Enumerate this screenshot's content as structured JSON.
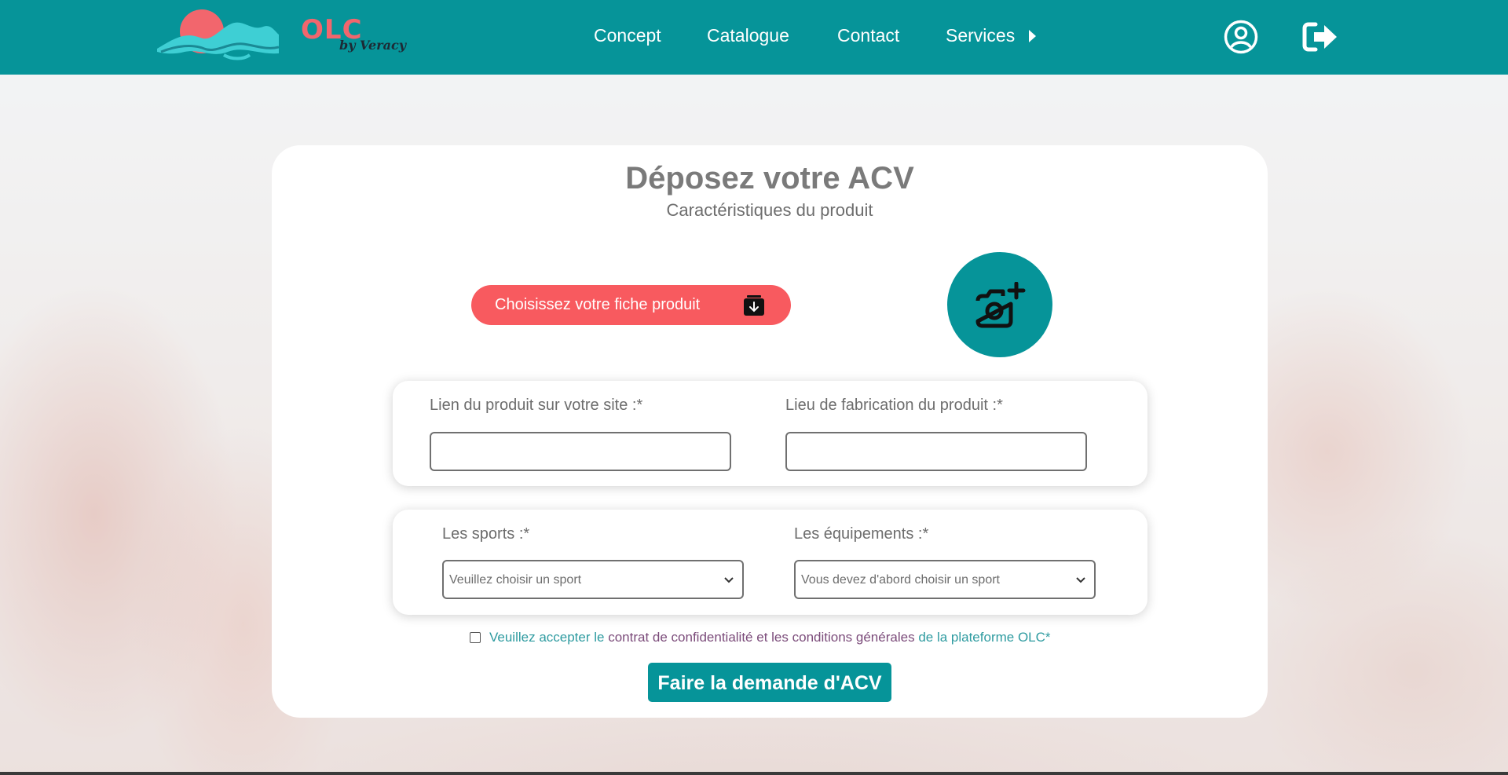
{
  "brand": {
    "name": "OLC",
    "tagline": "by Veracy"
  },
  "nav": {
    "items": [
      {
        "label": "Concept"
      },
      {
        "label": "Catalogue"
      },
      {
        "label": "Contact"
      },
      {
        "label": "Services"
      }
    ],
    "icons": [
      "user-circle-icon",
      "logout-icon"
    ]
  },
  "form": {
    "title": "Déposez votre ACV",
    "subtitle": "Caractéristiques du produit",
    "file_button_label": "Choisissez votre fiche produit",
    "file_button_icon": "download-box-icon",
    "photo_button_icon": "camera-add-icon",
    "product_link_label": "Lien du produit sur votre site :*",
    "product_link_value": "",
    "manufacture_place_label": "Lieu de fabrication du produit :*",
    "manufacture_place_value": "",
    "sports_label": "Les sports :*",
    "sports_selected": "Veuillez choisir un sport",
    "equipment_label": "Les équipements :*",
    "equipment_selected": "Vous devez d'abord choisir un sport",
    "consent": {
      "prefix": "Veuillez accepter le",
      "contract_link": "contrat de confidentialité",
      "middle": "et les",
      "conditions_link": "conditions générales",
      "suffix": "de la plateforme OLC*",
      "checked": false
    },
    "submit_label": "Faire la demande d'ACV"
  },
  "colors": {
    "header": "#069499",
    "accent_red": "#f85a5f",
    "teal": "#069499",
    "text_gray": "#6d6d6d"
  }
}
